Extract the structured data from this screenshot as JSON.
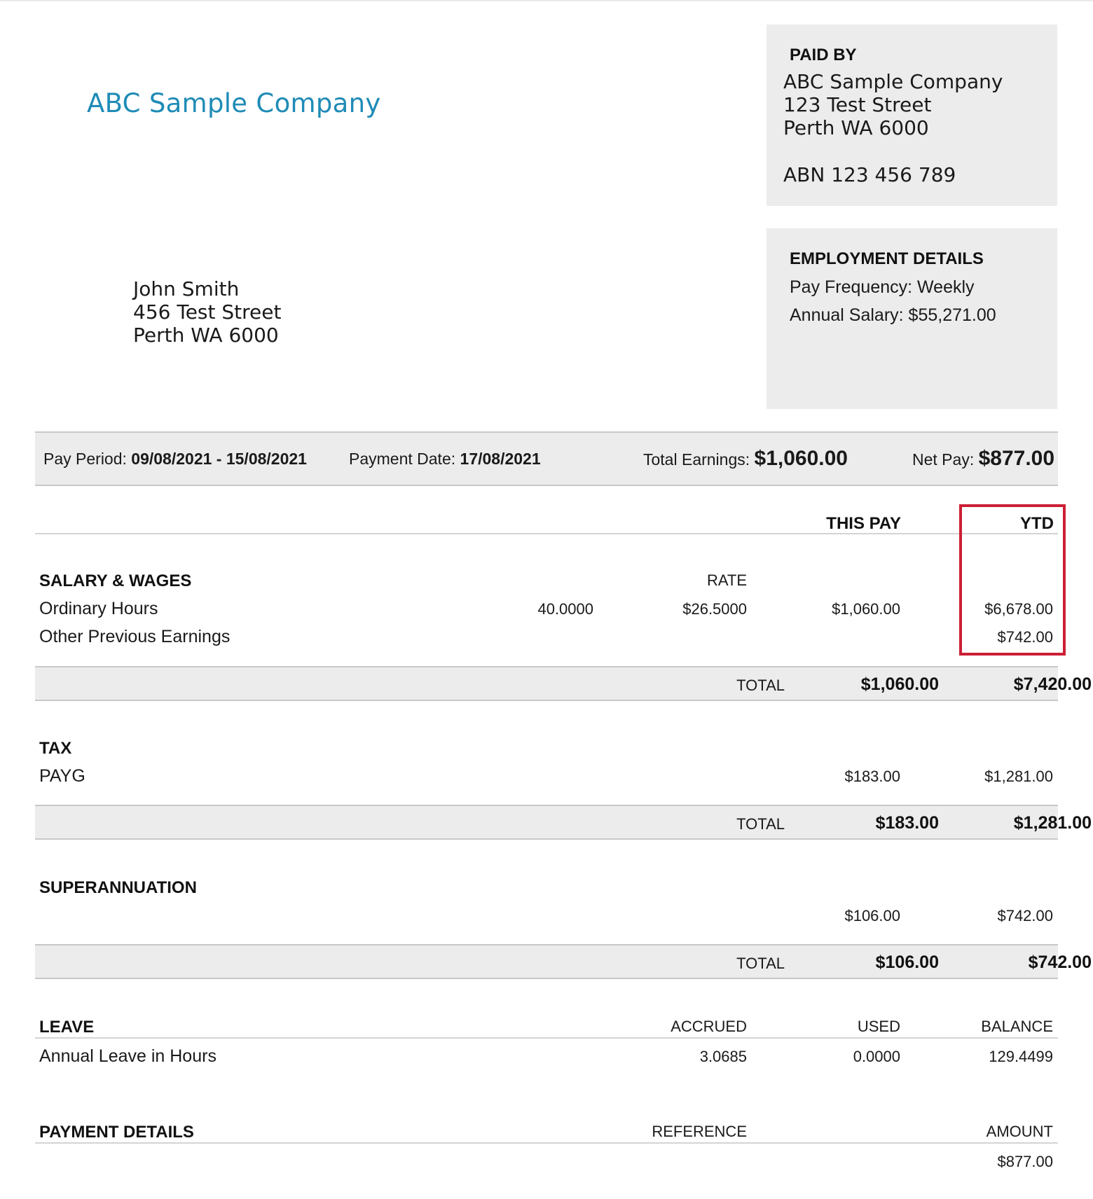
{
  "company_logo": "ABC Sample Company",
  "paid_by": {
    "title": "PAID BY",
    "name": "ABC Sample Company",
    "street": "123 Test Street",
    "city": "Perth WA 6000",
    "abn": "ABN 123 456 789"
  },
  "employee": {
    "name": "John Smith",
    "street": "456 Test Street",
    "city": "Perth WA 6000"
  },
  "employment": {
    "title": "EMPLOYMENT DETAILS",
    "pay_frequency": "Pay Frequency: Weekly",
    "annual_salary": "Annual Salary: $55,271.00"
  },
  "summary": {
    "pay_period_label": "Pay Period:",
    "pay_period_value": "09/08/2021 - 15/08/2021",
    "payment_date_label": "Payment Date:",
    "payment_date_value": "17/08/2021",
    "total_earnings_label": "Total Earnings:",
    "total_earnings_value": "$1,060.00",
    "net_pay_label": "Net Pay:",
    "net_pay_value": "$877.00"
  },
  "columns": {
    "this_pay": "THIS PAY",
    "ytd": "YTD"
  },
  "salary": {
    "title": "SALARY & WAGES",
    "rate_header": "RATE",
    "rows": [
      {
        "label": "Ordinary Hours",
        "hours": "40.0000",
        "rate": "$26.5000",
        "this_pay": "$1,060.00",
        "ytd": "$6,678.00"
      },
      {
        "label": "Other Previous Earnings",
        "ytd": "$742.00"
      }
    ],
    "total_label": "TOTAL",
    "total_this_pay": "$1,060.00",
    "total_ytd": "$7,420.00"
  },
  "tax": {
    "title": "TAX",
    "rows": [
      {
        "label": "PAYG",
        "this_pay": "$183.00",
        "ytd": "$1,281.00"
      }
    ],
    "total_label": "TOTAL",
    "total_this_pay": "$183.00",
    "total_ytd": "$1,281.00"
  },
  "super": {
    "title": "SUPERANNUATION",
    "this_pay": "$106.00",
    "ytd": "$742.00",
    "total_label": "TOTAL",
    "total_this_pay": "$106.00",
    "total_ytd": "$742.00"
  },
  "leave": {
    "title": "LEAVE",
    "accrued_header": "ACCRUED",
    "used_header": "USED",
    "balance_header": "BALANCE",
    "rows": [
      {
        "label": "Annual Leave in Hours",
        "accrued": "3.0685",
        "used": "0.0000",
        "balance": "129.4499"
      }
    ]
  },
  "payment": {
    "title": "PAYMENT DETAILS",
    "reference_header": "REFERENCE",
    "amount_header": "AMOUNT",
    "amount": "$877.00"
  },
  "highlight_color": "#cc1f36"
}
